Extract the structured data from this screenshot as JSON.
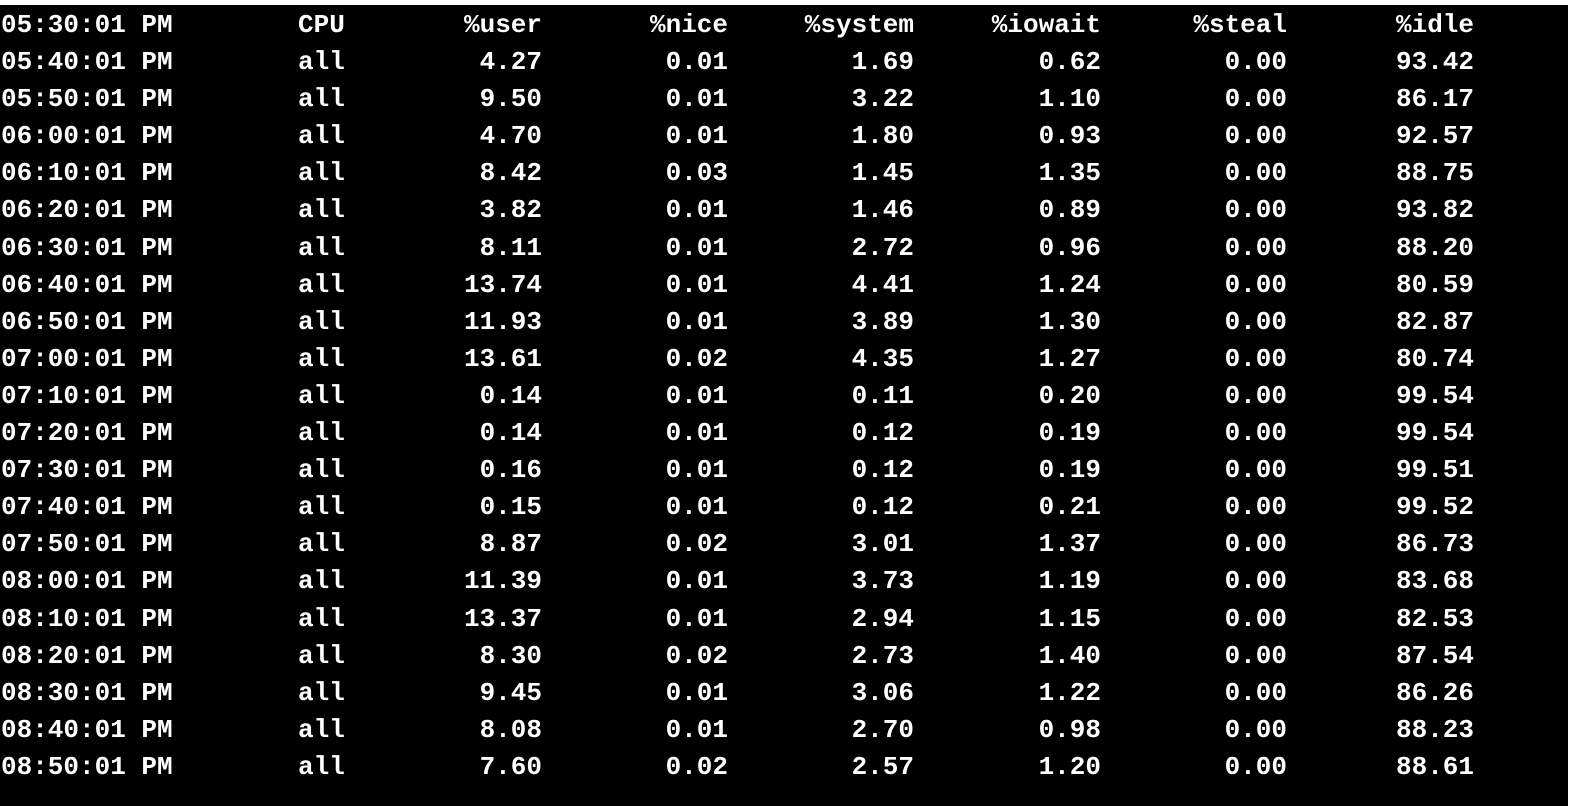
{
  "colors": {
    "background": "#000000",
    "foreground": "#ffffff",
    "frame": "#ffffff"
  },
  "header": {
    "time": "05:30:01 PM",
    "cpu": "CPU",
    "user": "%user",
    "nice": "%nice",
    "system": "%system",
    "iowait": "%iowait",
    "steal": "%steal",
    "idle": "%idle"
  },
  "rows": [
    {
      "time": "05:40:01 PM",
      "cpu": "all",
      "user": "4.27",
      "nice": "0.01",
      "system": "1.69",
      "iowait": "0.62",
      "steal": "0.00",
      "idle": "93.42"
    },
    {
      "time": "05:50:01 PM",
      "cpu": "all",
      "user": "9.50",
      "nice": "0.01",
      "system": "3.22",
      "iowait": "1.10",
      "steal": "0.00",
      "idle": "86.17"
    },
    {
      "time": "06:00:01 PM",
      "cpu": "all",
      "user": "4.70",
      "nice": "0.01",
      "system": "1.80",
      "iowait": "0.93",
      "steal": "0.00",
      "idle": "92.57"
    },
    {
      "time": "06:10:01 PM",
      "cpu": "all",
      "user": "8.42",
      "nice": "0.03",
      "system": "1.45",
      "iowait": "1.35",
      "steal": "0.00",
      "idle": "88.75"
    },
    {
      "time": "06:20:01 PM",
      "cpu": "all",
      "user": "3.82",
      "nice": "0.01",
      "system": "1.46",
      "iowait": "0.89",
      "steal": "0.00",
      "idle": "93.82"
    },
    {
      "time": "06:30:01 PM",
      "cpu": "all",
      "user": "8.11",
      "nice": "0.01",
      "system": "2.72",
      "iowait": "0.96",
      "steal": "0.00",
      "idle": "88.20"
    },
    {
      "time": "06:40:01 PM",
      "cpu": "all",
      "user": "13.74",
      "nice": "0.01",
      "system": "4.41",
      "iowait": "1.24",
      "steal": "0.00",
      "idle": "80.59"
    },
    {
      "time": "06:50:01 PM",
      "cpu": "all",
      "user": "11.93",
      "nice": "0.01",
      "system": "3.89",
      "iowait": "1.30",
      "steal": "0.00",
      "idle": "82.87"
    },
    {
      "time": "07:00:01 PM",
      "cpu": "all",
      "user": "13.61",
      "nice": "0.02",
      "system": "4.35",
      "iowait": "1.27",
      "steal": "0.00",
      "idle": "80.74"
    },
    {
      "time": "07:10:01 PM",
      "cpu": "all",
      "user": "0.14",
      "nice": "0.01",
      "system": "0.11",
      "iowait": "0.20",
      "steal": "0.00",
      "idle": "99.54"
    },
    {
      "time": "07:20:01 PM",
      "cpu": "all",
      "user": "0.14",
      "nice": "0.01",
      "system": "0.12",
      "iowait": "0.19",
      "steal": "0.00",
      "idle": "99.54"
    },
    {
      "time": "07:30:01 PM",
      "cpu": "all",
      "user": "0.16",
      "nice": "0.01",
      "system": "0.12",
      "iowait": "0.19",
      "steal": "0.00",
      "idle": "99.51"
    },
    {
      "time": "07:40:01 PM",
      "cpu": "all",
      "user": "0.15",
      "nice": "0.01",
      "system": "0.12",
      "iowait": "0.21",
      "steal": "0.00",
      "idle": "99.52"
    },
    {
      "time": "07:50:01 PM",
      "cpu": "all",
      "user": "8.87",
      "nice": "0.02",
      "system": "3.01",
      "iowait": "1.37",
      "steal": "0.00",
      "idle": "86.73"
    },
    {
      "time": "08:00:01 PM",
      "cpu": "all",
      "user": "11.39",
      "nice": "0.01",
      "system": "3.73",
      "iowait": "1.19",
      "steal": "0.00",
      "idle": "83.68"
    },
    {
      "time": "08:10:01 PM",
      "cpu": "all",
      "user": "13.37",
      "nice": "0.01",
      "system": "2.94",
      "iowait": "1.15",
      "steal": "0.00",
      "idle": "82.53"
    },
    {
      "time": "08:20:01 PM",
      "cpu": "all",
      "user": "8.30",
      "nice": "0.02",
      "system": "2.73",
      "iowait": "1.40",
      "steal": "0.00",
      "idle": "87.54"
    },
    {
      "time": "08:30:01 PM",
      "cpu": "all",
      "user": "9.45",
      "nice": "0.01",
      "system": "3.06",
      "iowait": "1.22",
      "steal": "0.00",
      "idle": "86.26"
    },
    {
      "time": "08:40:01 PM",
      "cpu": "all",
      "user": "8.08",
      "nice": "0.01",
      "system": "2.70",
      "iowait": "0.98",
      "steal": "0.00",
      "idle": "88.23"
    },
    {
      "time": "08:50:01 PM",
      "cpu": "all",
      "user": "7.60",
      "nice": "0.02",
      "system": "2.57",
      "iowait": "1.20",
      "steal": "0.00",
      "idle": "88.61"
    }
  ]
}
